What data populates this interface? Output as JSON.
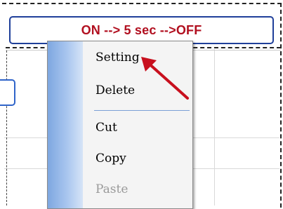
{
  "state_bar": {
    "label": "ON --> 5 sec -->OFF"
  },
  "context_menu": {
    "items": [
      {
        "label": "Setting",
        "enabled": true
      },
      {
        "label": "Delete",
        "enabled": true
      },
      {
        "label": "Cut",
        "enabled": true
      },
      {
        "label": "Copy",
        "enabled": true
      },
      {
        "label": "Paste",
        "enabled": false
      }
    ]
  },
  "colors": {
    "state_text": "#b10f1f",
    "state_border": "#1f3f9a",
    "arrow": "#c8101e",
    "menu_gutter": "#7ea7e0"
  }
}
